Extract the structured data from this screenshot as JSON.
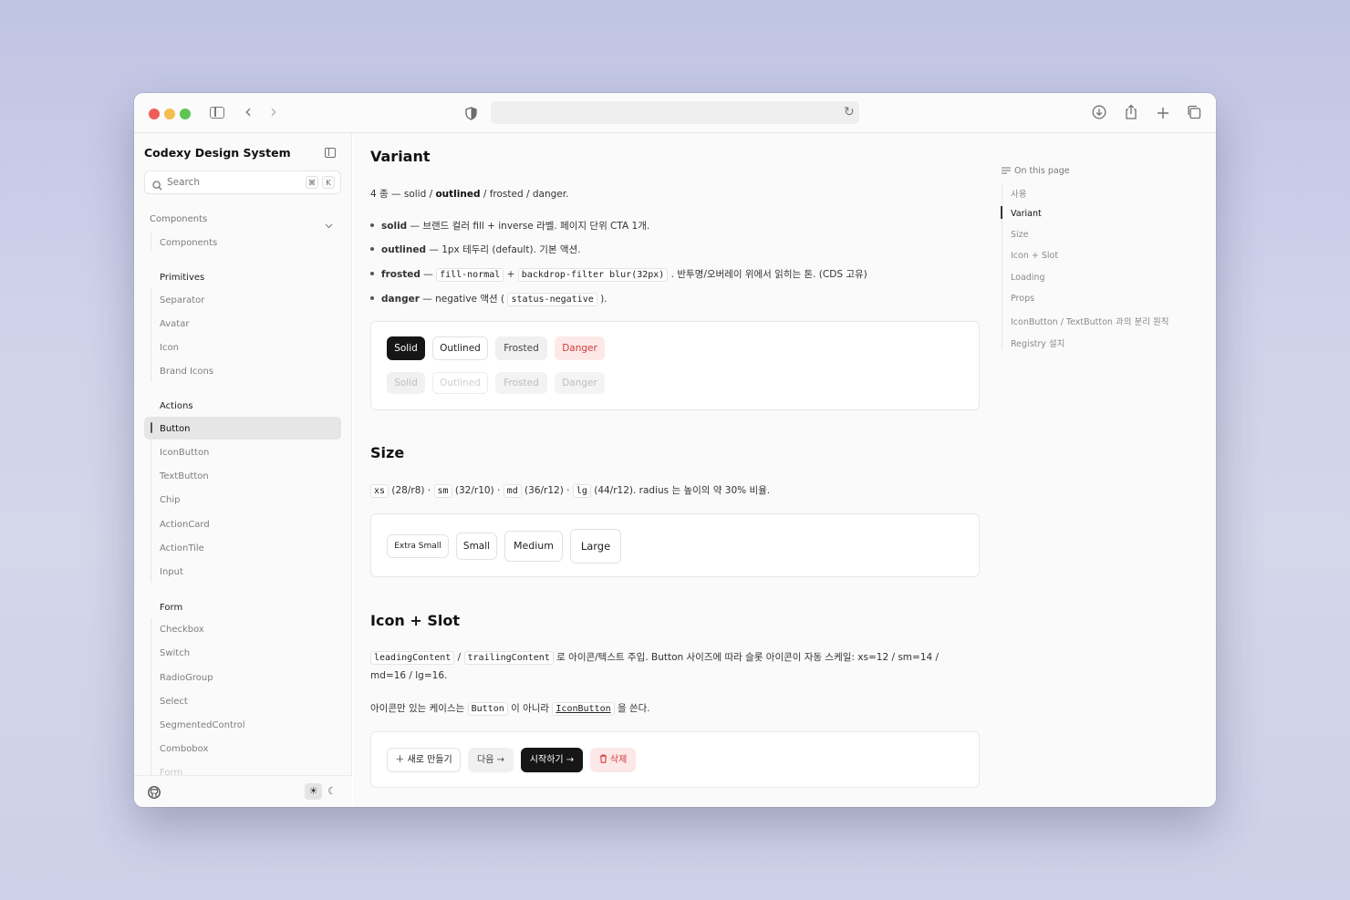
{
  "browser": {
    "nav_back_glyph": "‹",
    "nav_forward_glyph": "›",
    "reload_glyph": "↻",
    "icons": [
      "sidebar-toggle-icon",
      "back-icon",
      "forward-icon",
      "shield-icon",
      "reload-icon",
      "download-icon",
      "share-icon",
      "new-tab-icon",
      "tabs-overview-icon"
    ],
    "traffic_lights": [
      "#ee5e57",
      "#f4bd4f",
      "#5fc454"
    ]
  },
  "sidebar": {
    "brand": "Codexy Design System",
    "search_placeholder": "Search",
    "shortcut_cmd": "⌘",
    "shortcut_key": "K",
    "sections": {
      "components_group": "Components",
      "components_item": "Components",
      "primitives": "Primitives",
      "primitives_items": [
        "Separator",
        "Avatar",
        "Icon",
        "Brand Icons"
      ],
      "actions": "Actions",
      "actions_items": [
        "Button",
        "IconButton",
        "TextButton",
        "Chip",
        "ActionCard",
        "ActionTile",
        "Input"
      ],
      "form": "Form",
      "form_items": [
        "Checkbox",
        "Switch",
        "RadioGroup",
        "Select",
        "SegmentedControl",
        "Combobox",
        "Form"
      ]
    },
    "footer": {
      "sun": "☀",
      "moon": "☾"
    }
  },
  "main": {
    "variant": {
      "title": "Variant",
      "intro_pre": "4 종 — solid / ",
      "intro_bold": "outlined",
      "intro_post": " / frosted / danger.",
      "b1_bold": "solid",
      "b1_text": " — 브랜드 컬러 fill + inverse 라벨. 페이지 단위 CTA 1개.",
      "b2_bold": "outlined",
      "b2_text": " — 1px 테두리 (default). 기본 액션.",
      "b3_bold": "frosted",
      "b3_dash": " — ",
      "b3_code1": "fill-normal",
      "b3_plus": " + ",
      "b3_code2": "backdrop-filter blur(32px)",
      "b3_text": " . 반투명/오버레이 위에서 읽히는 톤. (CDS 고유)",
      "b4_bold": "danger",
      "b4_text": " — negative 액션 ( ",
      "b4_code": "status-negative",
      "b4_end": " ).",
      "buttons": [
        "Solid",
        "Outlined",
        "Frosted",
        "Danger"
      ],
      "disabled_buttons": [
        "Solid",
        "Outlined",
        "Frosted",
        "Danger"
      ]
    },
    "size": {
      "title": "Size",
      "c_xs": "xs",
      "t_xs": " (28/r8) · ",
      "c_sm": "sm",
      "t_sm": " (32/r10) · ",
      "c_md": "md",
      "t_md": " (36/r12) · ",
      "c_lg": "lg",
      "t_lg": " (44/r12). radius 는 높이의 약 30% 비율.",
      "buttons": [
        "Extra Small",
        "Small",
        "Medium",
        "Large"
      ]
    },
    "slot": {
      "title": "Icon + Slot",
      "c1": "leadingContent",
      "sep": " / ",
      "c2": "trailingContent",
      "line1": " 로 아이콘/텍스트 주입. Button 사이즈에 따라 슬롯 아이콘이 자동 스케일: xs=12 / sm=14 /",
      "line2": "md=16 / lg=16.",
      "l3_pre": "아이콘만 있는 케이스는 ",
      "l3_c1": "Button",
      "l3_mid": " 이 아니라 ",
      "l3_c2": "IconButton",
      "l3_post": " 을 쓴다.",
      "btn_new": "새로 만들기",
      "btn_next": "다음",
      "btn_start": "시작하기",
      "btn_delete": "삭제"
    }
  },
  "toc": {
    "heading": "On this page",
    "items": [
      "사용",
      "Variant",
      "Size",
      "Icon + Slot",
      "Loading",
      "Props",
      "IconButton / TextButton 과의 분리 원칙",
      "Registry 설치"
    ]
  }
}
